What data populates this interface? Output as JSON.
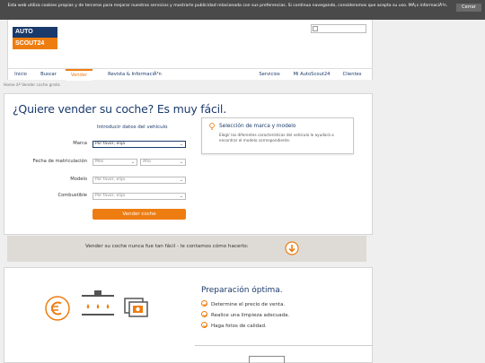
{
  "cookie_bar": {
    "text": "Esta web utiliza cookies propias y de terceros para mejorar nuestros servicios y mostrarle publicidad relacionada con sus preferencias. Si continua navegando, consideramos que acepta su uso. MÃ¡s informaciÃ³n.",
    "close_label": "Cerrar"
  },
  "logo": {
    "line1": "AUTO",
    "line2": "SCOUT24"
  },
  "nav": {
    "items": [
      "Inicio",
      "Buscar",
      "Vender",
      "Revista & InformaciÃ³n",
      "Servicios",
      "Mi AutoScout24",
      "Clientes"
    ],
    "active": "Vender"
  },
  "breadcrumb": "Home âº Vender coche gratis",
  "form": {
    "title": "¿Quiere vender su coche? Es muy fácil.",
    "subtitle": "Introducir datos del vehículo",
    "fields": {
      "marca": {
        "label": "Marca",
        "placeholder": "Por favor, elija"
      },
      "fecha": {
        "label": "Fecha de matriculación",
        "mes": "Mes",
        "ano": "Año"
      },
      "modelo": {
        "label": "Modelo",
        "placeholder": "Por favor, elija"
      },
      "combustible": {
        "label": "Combustible",
        "placeholder": "Por favor, elija"
      }
    },
    "submit_label": "Vender coche"
  },
  "tooltip": {
    "title": "Selección de marca y modelo",
    "body": "Elegir las diferentes características del vehículo le ayudará a encontrar el modelo correspondiente."
  },
  "info_band": {
    "text": "Vender su coche nunca fue tan fácil - le contamos cómo hacerlo:"
  },
  "prep": {
    "title": "Preparación óptima.",
    "items": [
      "Determine el precio de venta.",
      "Realice una limpieza adecuada.",
      "Haga fotos de calidad."
    ],
    "icons": [
      "euro-icon",
      "car-wash-icon",
      "camera-photo-icon"
    ]
  },
  "colors": {
    "brand_blue": "#1a3a6b",
    "brand_orange": "#ee7d11"
  }
}
